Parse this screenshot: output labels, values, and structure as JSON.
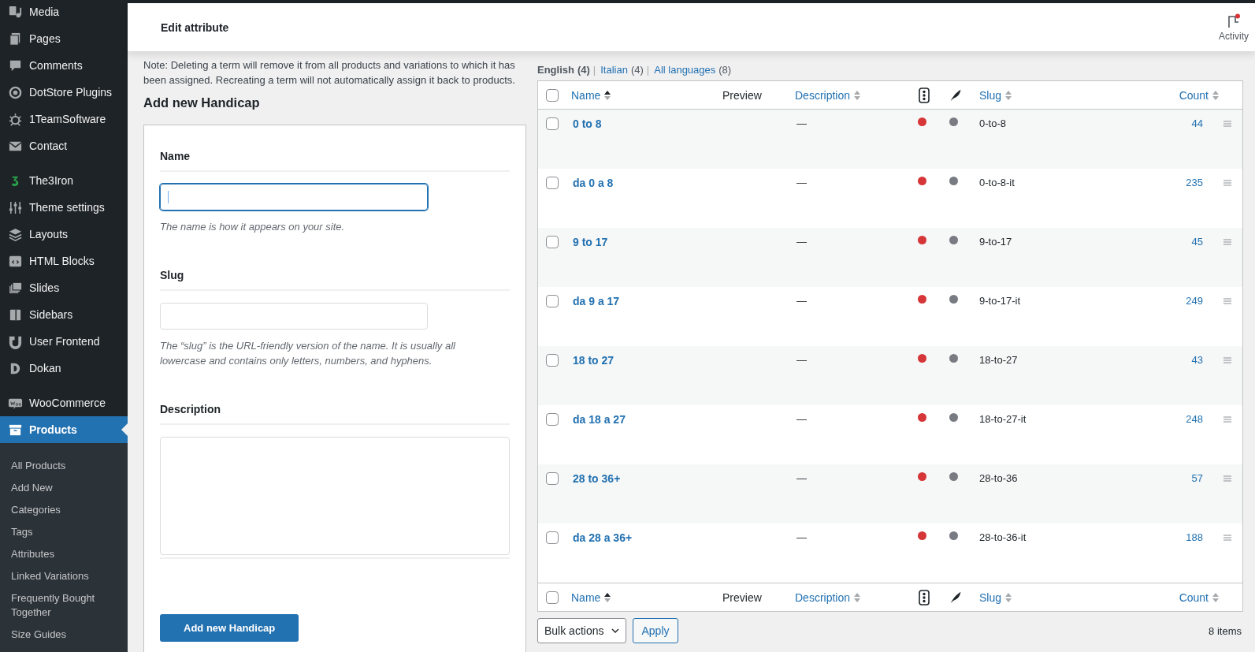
{
  "sidebar": {
    "items": [
      {
        "label": "Media",
        "selected": false
      },
      {
        "label": "Pages",
        "selected": false
      },
      {
        "label": "Comments",
        "selected": false
      },
      {
        "label": "DotStore Plugins",
        "selected": false
      },
      {
        "label": "1TeamSoftware",
        "selected": false
      },
      {
        "label": "Contact",
        "selected": false
      },
      {
        "label": "The3Iron",
        "selected": false
      },
      {
        "label": "Theme settings",
        "selected": false
      },
      {
        "label": "Layouts",
        "selected": false
      },
      {
        "label": "HTML Blocks",
        "selected": false
      },
      {
        "label": "Slides",
        "selected": false
      },
      {
        "label": "Sidebars",
        "selected": false
      },
      {
        "label": "User Frontend",
        "selected": false
      },
      {
        "label": "Dokan",
        "selected": false
      },
      {
        "label": "WooCommerce",
        "selected": false
      },
      {
        "label": "Products",
        "selected": true
      }
    ],
    "submenu": [
      "All Products",
      "Add New",
      "Categories",
      "Tags",
      "Attributes",
      "Linked Variations",
      "Frequently Bought Together",
      "Size Guides"
    ]
  },
  "header": {
    "title": "Edit attribute",
    "activity": "Activity",
    "activity_unread": true
  },
  "note": "Note: Deleting a term will remove it from all products and variations to which it has been assigned. Recreating a term will not automatically assign it back to products.",
  "form": {
    "heading": "Add new Handicap",
    "name": {
      "label": "Name",
      "help": "The name is how it appears on your site.",
      "focused": true
    },
    "slug": {
      "label": "Slug",
      "help": "The “slug” is the URL-friendly version of the name. It is usually all lowercase and contains only letters, numbers, and hyphens."
    },
    "description": {
      "label": "Description"
    },
    "submit": "Add new Handicap"
  },
  "language_filter": [
    {
      "label": "English",
      "count": "(4)",
      "separator": "|",
      "selected": true
    },
    {
      "label": "Italian",
      "count": "(4)",
      "separator": "|",
      "selected": false
    },
    {
      "label": "All languages",
      "count": "(8)",
      "selected": false
    }
  ],
  "table": {
    "header": {
      "select_all_checked": false,
      "columns": [
        {
          "kind": "sortable",
          "label": "Name",
          "sorted": true
        },
        {
          "kind": "plain",
          "label": "Preview"
        },
        {
          "kind": "sortable",
          "label": "Description",
          "sorted": false
        },
        {
          "kind": "traffic"
        },
        {
          "kind": "feather"
        },
        {
          "kind": "sortable",
          "label": "Slug",
          "sorted": false
        },
        {
          "kind": "sortable",
          "label": "Count",
          "sorted": false
        }
      ]
    },
    "rows": [
      {
        "name": "0 to 8",
        "description": "—",
        "slug": "0-to-8",
        "count": "44",
        "checked": false
      },
      {
        "name": "da 0 a 8",
        "description": "—",
        "slug": "0-to-8-it",
        "count": "235",
        "checked": false
      },
      {
        "name": "9 to 17",
        "description": "—",
        "slug": "9-to-17",
        "count": "45",
        "checked": false
      },
      {
        "name": "da 9 a 17",
        "description": "—",
        "slug": "9-to-17-it",
        "count": "249",
        "checked": false
      },
      {
        "name": "18 to 27",
        "description": "—",
        "slug": "18-to-27",
        "count": "43",
        "checked": false
      },
      {
        "name": "da 18 a 27",
        "description": "—",
        "slug": "18-to-27-it",
        "count": "248",
        "checked": false
      },
      {
        "name": "28 to 36+",
        "description": "—",
        "slug": "28-to-36",
        "count": "57",
        "checked": false
      },
      {
        "name": "da 28 a 36+",
        "description": "—",
        "slug": "28-to-36-it",
        "count": "188",
        "checked": false
      }
    ],
    "footer": {
      "select_all_checked": false,
      "columns": [
        {
          "kind": "sortable",
          "label": "Name",
          "sorted": true
        },
        {
          "kind": "plain",
          "label": "Preview"
        },
        {
          "kind": "sortable",
          "label": "Description",
          "sorted": false
        },
        {
          "kind": "traffic"
        },
        {
          "kind": "feather"
        },
        {
          "kind": "sortable",
          "label": "Slug",
          "sorted": false
        },
        {
          "kind": "sortable",
          "label": "Count",
          "sorted": false
        }
      ]
    }
  },
  "bulk": {
    "select": "Bulk actions",
    "apply": "Apply"
  },
  "item_count": "8 items"
}
